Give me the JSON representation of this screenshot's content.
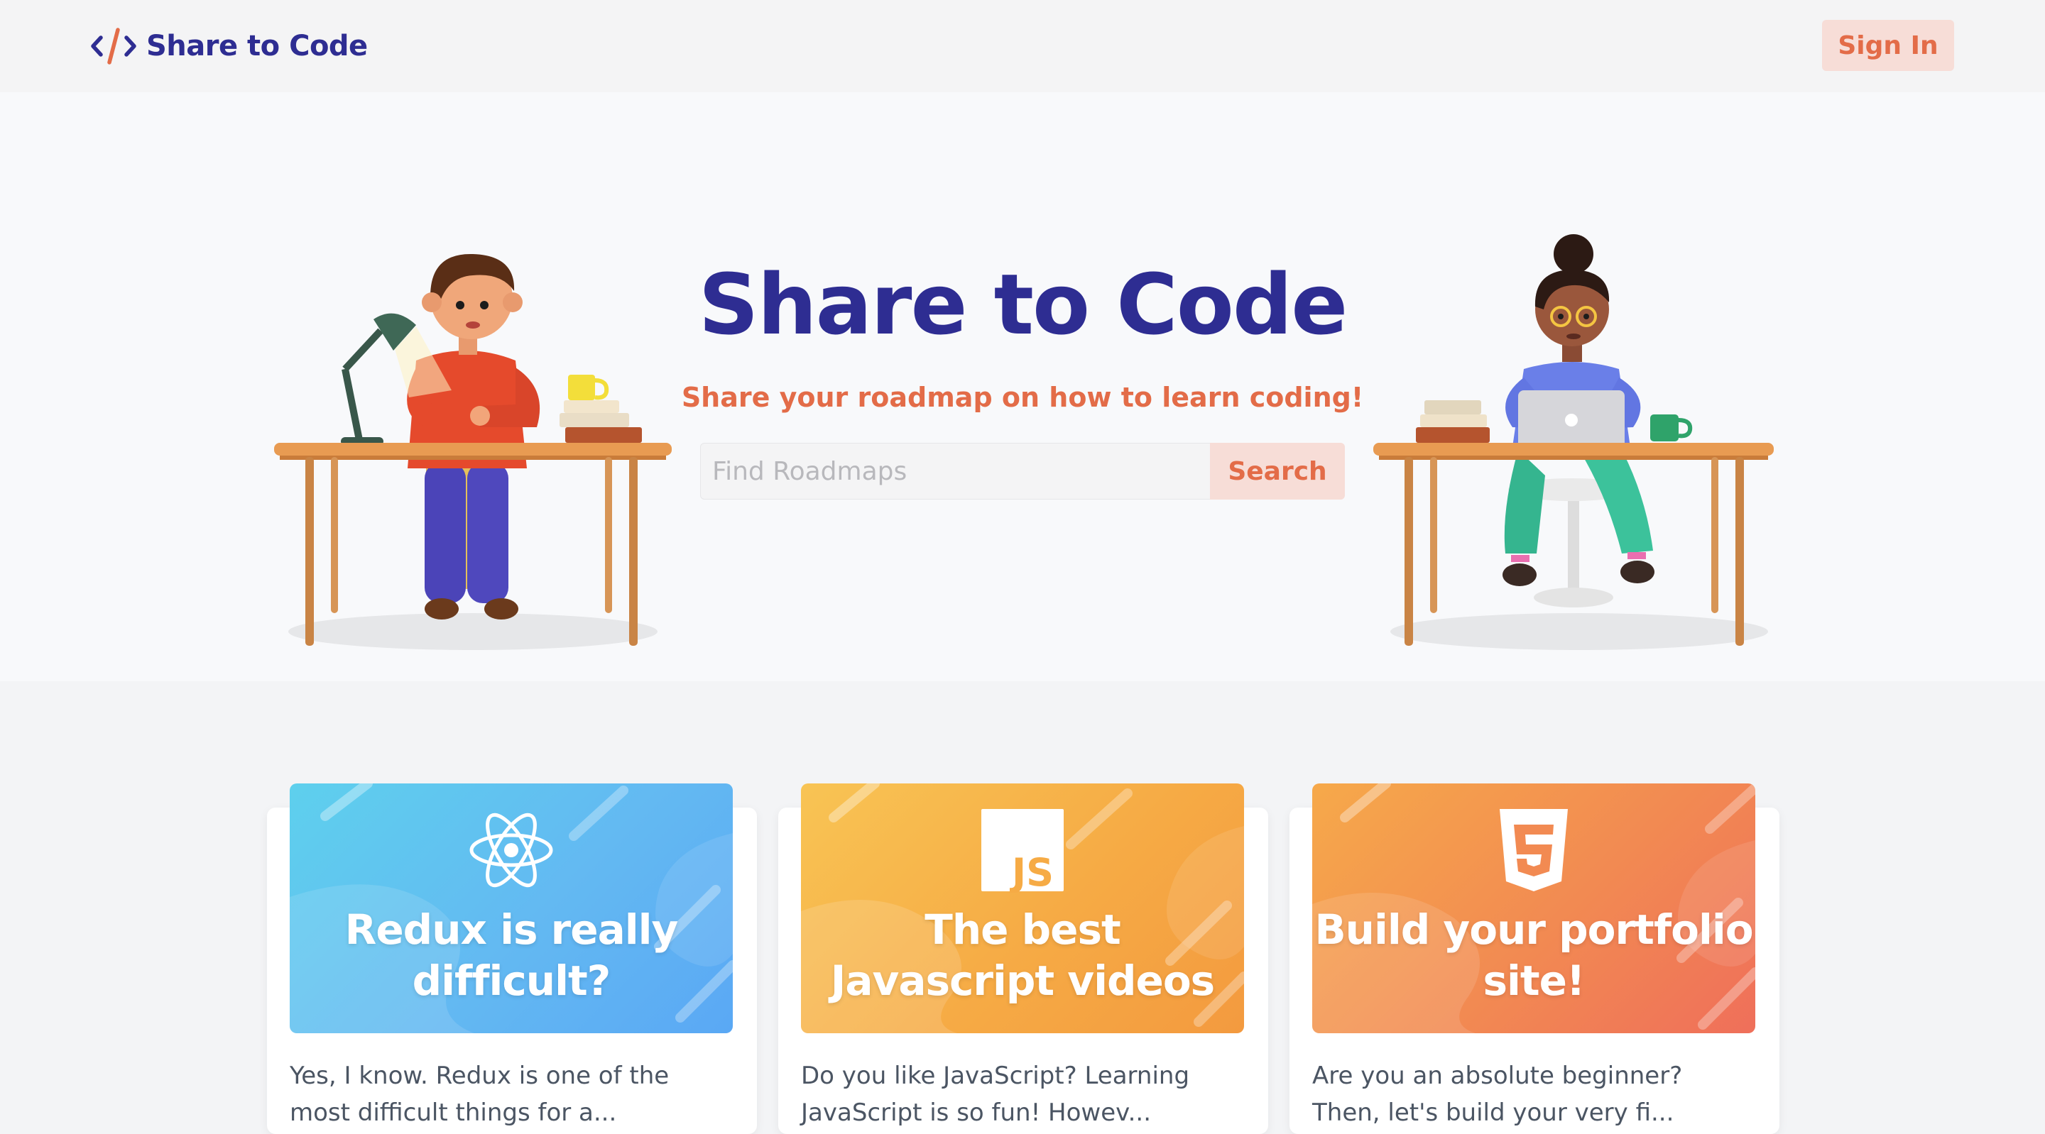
{
  "app": {
    "name": "Share to Code",
    "brand_color": "#2e2d92",
    "accent_color": "#e36c48"
  },
  "header": {
    "logo_icon": "code-brackets-icon",
    "logo_text": "Share to Code",
    "signin_label": "Sign In"
  },
  "hero": {
    "title": "Share to Code",
    "subtitle": "Share your roadmap on how to learn coding!",
    "search": {
      "placeholder": "Find Roadmaps",
      "value": "",
      "button_label": "Search"
    },
    "illustrations": [
      "person-at-desk-writing",
      "person-at-desk-laptop"
    ]
  },
  "cards": [
    {
      "icon": "react-atom-icon",
      "title_line1": "Redux is really",
      "title_line2": "difficult?",
      "description": "Yes, I know. Redux is one of the most difficult things for a...",
      "banner_color": "#63b9f2"
    },
    {
      "icon": "js-logo-icon",
      "icon_text": "JS",
      "title_line1": "The best",
      "title_line2": "Javascript videos",
      "description": "Do you like JavaScript? Learning JavaScript is so fun! Howev...",
      "banner_color": "#f6ab45"
    },
    {
      "icon": "html5-shield-icon",
      "title_line1": "Build your portfolio",
      "title_line2": "site!",
      "description": "Are you an absolute beginner? Then, let's build your very fi...",
      "banner_color": "#f28a52"
    }
  ]
}
